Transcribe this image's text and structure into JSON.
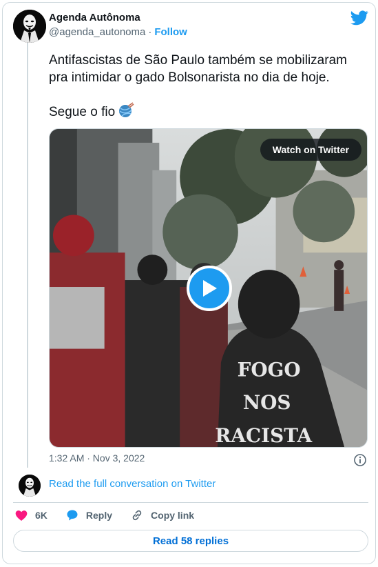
{
  "author": {
    "name": "Agenda Autônoma",
    "handle": "@agenda_autonoma",
    "separator": "·",
    "follow_label": "Follow"
  },
  "tweet": {
    "line1": "Antifascistas de São Paulo também se mobilizaram",
    "line2": "pra intimidar o gado Bolsonarista no dia de hoje.",
    "line3": "Segue o fio",
    "emoji": "yarn-ball-icon"
  },
  "media": {
    "watch_label": "Watch on Twitter",
    "hoodie_text": [
      "FOGO",
      "NOS",
      "RACISTA"
    ]
  },
  "timestamp": "1:32 AM · Nov 3, 2022",
  "conversation_link": "Read the full conversation on Twitter",
  "actions": {
    "likes": "6K",
    "reply_label": "Reply",
    "copy_label": "Copy link"
  },
  "replies_button": "Read 58 replies",
  "colors": {
    "accent": "#1d9bf0",
    "like": "#f91880",
    "muted": "#536471",
    "border": "#cfd9de"
  }
}
